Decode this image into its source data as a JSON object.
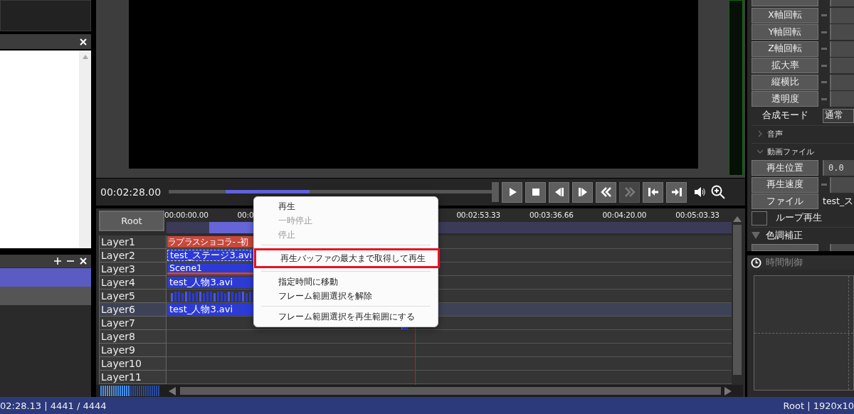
{
  "preview": {
    "time": "00:02:28.00"
  },
  "transport": [
    {
      "kind": "play",
      "disabled": false
    },
    {
      "kind": "stop",
      "disabled": false
    },
    {
      "kind": "prev-frame",
      "disabled": false
    },
    {
      "kind": "next-frame",
      "disabled": false
    },
    {
      "kind": "rewind",
      "disabled": false
    },
    {
      "kind": "forward",
      "disabled": true
    },
    {
      "kind": "to-start",
      "disabled": false
    },
    {
      "kind": "to-end",
      "disabled": false
    }
  ],
  "timeline": {
    "root": "Root",
    "ruler": [
      "00:00:00.00",
      "00:0",
      "00:02:53.33",
      "00:03:36.66",
      "00:04:20.00",
      "00:05:03.33"
    ],
    "layers": [
      {
        "name": "Layer1",
        "selected": false,
        "clips": [
          {
            "kind": "text",
            "label": "ラプラスショコラ- -初"
          }
        ]
      },
      {
        "name": "Layer2",
        "selected": false,
        "clips": [
          {
            "kind": "video-dashed",
            "label": "test_ステージ3.avi"
          }
        ]
      },
      {
        "name": "Layer3",
        "selected": false,
        "clips": [
          {
            "kind": "scene",
            "label": "Scene1"
          }
        ]
      },
      {
        "name": "Layer4",
        "selected": false,
        "clips": [
          {
            "kind": "video",
            "label": "test_人物3.avi"
          }
        ]
      },
      {
        "name": "Layer5",
        "selected": false,
        "clips": [
          {
            "kind": "audio"
          }
        ]
      },
      {
        "name": "Layer6",
        "selected": true,
        "clips": [
          {
            "kind": "video",
            "label": "test_人物3.avi"
          }
        ]
      },
      {
        "name": "Layer7",
        "selected": false,
        "clips": [
          {
            "kind": "marker"
          }
        ]
      },
      {
        "name": "Layer8",
        "selected": false
      },
      {
        "name": "Layer9",
        "selected": false
      },
      {
        "name": "Layer10",
        "selected": false
      },
      {
        "name": "Layer11",
        "selected": false
      }
    ]
  },
  "context_menu": [
    {
      "kind": "item",
      "label": "再生",
      "disabled": false,
      "highlighted": false
    },
    {
      "kind": "item",
      "label": "一時停止",
      "disabled": true,
      "highlighted": false
    },
    {
      "kind": "item",
      "label": "停止",
      "disabled": true,
      "highlighted": false
    },
    {
      "kind": "separator"
    },
    {
      "kind": "item",
      "label": "再生バッファの最大まで取得して再生",
      "disabled": false,
      "highlighted": true
    },
    {
      "kind": "separator"
    },
    {
      "kind": "item",
      "label": "指定時間に移動",
      "disabled": false,
      "highlighted": false
    },
    {
      "kind": "item",
      "label": "フレーム範囲選択を解除",
      "disabled": false,
      "highlighted": false
    },
    {
      "kind": "separator"
    },
    {
      "kind": "item",
      "label": "フレーム範囲選択を再生範囲にする",
      "disabled": false,
      "highlighted": false
    }
  ],
  "properties": [
    {
      "kind": "stub-top"
    },
    {
      "kind": "slider",
      "label": "X軸回転"
    },
    {
      "kind": "slider",
      "label": "Y軸回転"
    },
    {
      "kind": "slider",
      "label": "Z軸回転"
    },
    {
      "kind": "slider",
      "label": "拡大率"
    },
    {
      "kind": "slider",
      "label": "縦横比"
    },
    {
      "kind": "slider",
      "label": "透明度"
    },
    {
      "kind": "select",
      "label": "合成モード",
      "value": "通常"
    },
    {
      "kind": "section",
      "label": "音声",
      "expanded": false
    },
    {
      "kind": "section",
      "label": "動画ファイル",
      "expanded": true
    },
    {
      "kind": "number",
      "label": "再生位置",
      "value": "0.0"
    },
    {
      "kind": "slider",
      "label": "再生速度"
    },
    {
      "kind": "file",
      "label": "ファイル",
      "value": "test_ス"
    },
    {
      "kind": "checkbox",
      "label": "ループ再生",
      "checked": false
    },
    {
      "kind": "group",
      "label": "色調補正",
      "expanded": true
    },
    {
      "kind": "stub"
    }
  ],
  "time_control": {
    "title": "時間制御"
  },
  "status_bar": {
    "left": "02:28.13 | 4441 / 4444",
    "right": "Root | 1920x10"
  }
}
